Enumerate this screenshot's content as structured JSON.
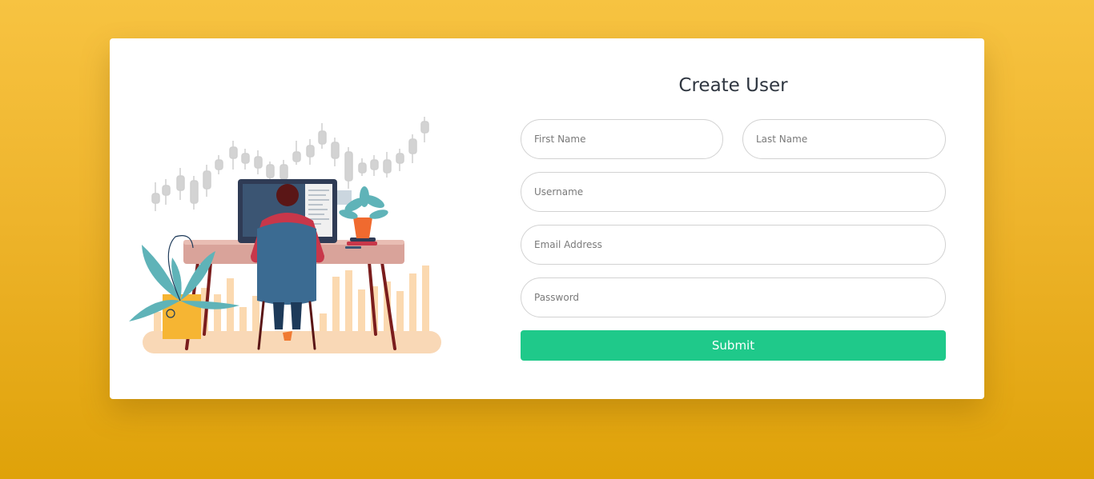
{
  "form": {
    "title": "Create User",
    "first_name_placeholder": "First Name",
    "last_name_placeholder": "Last Name",
    "username_placeholder": "Username",
    "email_placeholder": "Email Address",
    "password_placeholder": "Password",
    "submit_label": "Submit"
  },
  "colors": {
    "background_top": "#f7c341",
    "background_bottom": "#dfa209",
    "card": "#ffffff",
    "submit": "#1fc98a",
    "title_text": "#2f3640"
  }
}
